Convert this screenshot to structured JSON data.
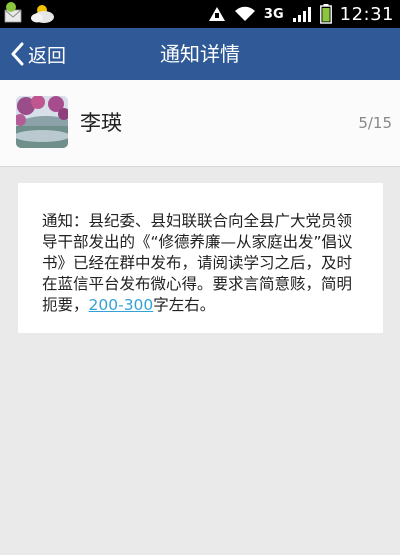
{
  "status_bar": {
    "network": "3G",
    "time": "12:31",
    "icons": [
      "email-icon",
      "weather-icon",
      "upload-icon",
      "wifi-icon",
      "signal-icon",
      "battery-icon"
    ]
  },
  "header": {
    "back_label": "返回",
    "title": "通知详情",
    "background": "#2f5a97"
  },
  "sender": {
    "name": "李瑛",
    "page_counter": "5/15"
  },
  "message": {
    "text_before_link": "通知：县纪委、县妇联联合向全县广大党员领导干部发出的《“修德养廉—从家庭出发”倡议书》已经在群中发布，请阅读学习之后，及时在蓝信平台发布微心得。要求言简意赅，简明扼要，",
    "link_text": "200-300",
    "text_after_link": "字左右。",
    "link_color": "#33a3d6"
  }
}
